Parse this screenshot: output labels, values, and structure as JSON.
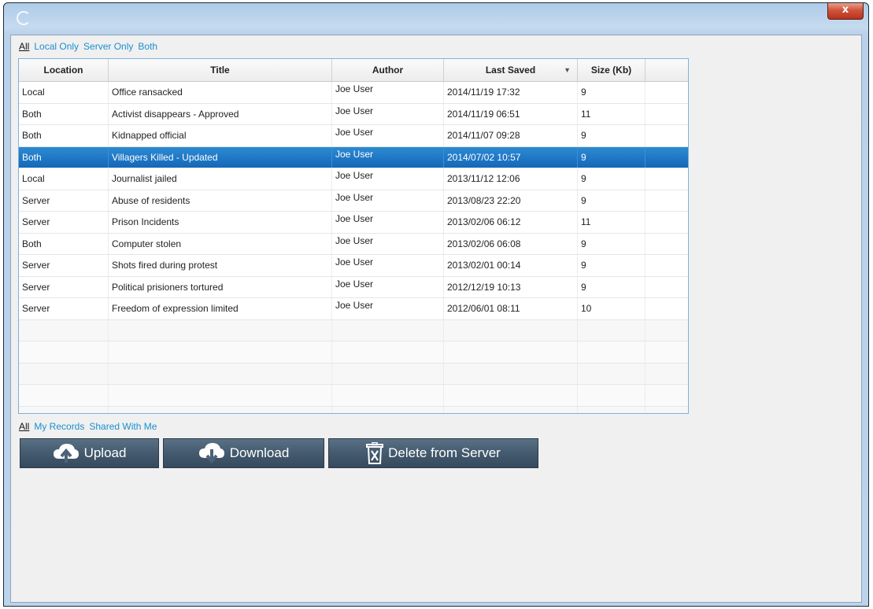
{
  "window": {
    "close_glyph": "x"
  },
  "top_filters": [
    {
      "label": "All",
      "active": true
    },
    {
      "label": "Local Only",
      "active": false
    },
    {
      "label": "Server Only",
      "active": false
    },
    {
      "label": "Both",
      "active": false
    }
  ],
  "table": {
    "columns": [
      "Location",
      "Title",
      "Author",
      "Last Saved",
      "Size (Kb)",
      ""
    ],
    "sort_column": "Last Saved",
    "sort_direction": "descending",
    "rows": [
      {
        "location": "Local",
        "title": "Office ransacked",
        "author": "Joe User",
        "last_saved": "2014/11/19 17:32",
        "size": "9",
        "selected": false
      },
      {
        "location": "Both",
        "title": "Activist disappears - Approved",
        "author": "Joe User",
        "last_saved": "2014/11/19 06:51",
        "size": "11",
        "selected": false
      },
      {
        "location": "Both",
        "title": "Kidnapped official",
        "author": "Joe User",
        "last_saved": "2014/11/07 09:28",
        "size": "9",
        "selected": false
      },
      {
        "location": "Both",
        "title": "Villagers Killed - Updated",
        "author": "Joe User",
        "last_saved": "2014/07/02 10:57",
        "size": "9",
        "selected": true
      },
      {
        "location": "Local",
        "title": "Journalist jailed",
        "author": "Joe User",
        "last_saved": "2013/11/12 12:06",
        "size": "9",
        "selected": false
      },
      {
        "location": "Server",
        "title": "Abuse of residents",
        "author": "Joe User",
        "last_saved": "2013/08/23 22:20",
        "size": "9",
        "selected": false
      },
      {
        "location": "Server",
        "title": "Prison Incidents",
        "author": "Joe User",
        "last_saved": "2013/02/06 06:12",
        "size": "11",
        "selected": false
      },
      {
        "location": "Both",
        "title": "Computer stolen",
        "author": "Joe User",
        "last_saved": "2013/02/06 06:08",
        "size": "9",
        "selected": false
      },
      {
        "location": "Server",
        "title": "Shots fired during protest",
        "author": "Joe User",
        "last_saved": "2013/02/01 00:14",
        "size": "9",
        "selected": false
      },
      {
        "location": "Server",
        "title": "Political prisioners tortured",
        "author": "Joe User",
        "last_saved": "2012/12/19 10:13",
        "size": "9",
        "selected": false
      },
      {
        "location": "Server",
        "title": "Freedom of expression limited",
        "author": "Joe User",
        "last_saved": "2012/06/01 08:11",
        "size": "10",
        "selected": false
      }
    ]
  },
  "bottom_filters": [
    {
      "label": "All",
      "active": true
    },
    {
      "label": "My Records",
      "active": false
    },
    {
      "label": "Shared With Me",
      "active": false
    }
  ],
  "buttons": [
    {
      "label": "Upload",
      "icon": "cloud-upload-icon"
    },
    {
      "label": "Download",
      "icon": "cloud-download-icon"
    },
    {
      "label": "Delete from Server",
      "icon": "trash-delete-icon"
    }
  ],
  "colors": {
    "accent": "#1a8fd0",
    "selection": "#1c72c2",
    "button": "#445a6e"
  }
}
